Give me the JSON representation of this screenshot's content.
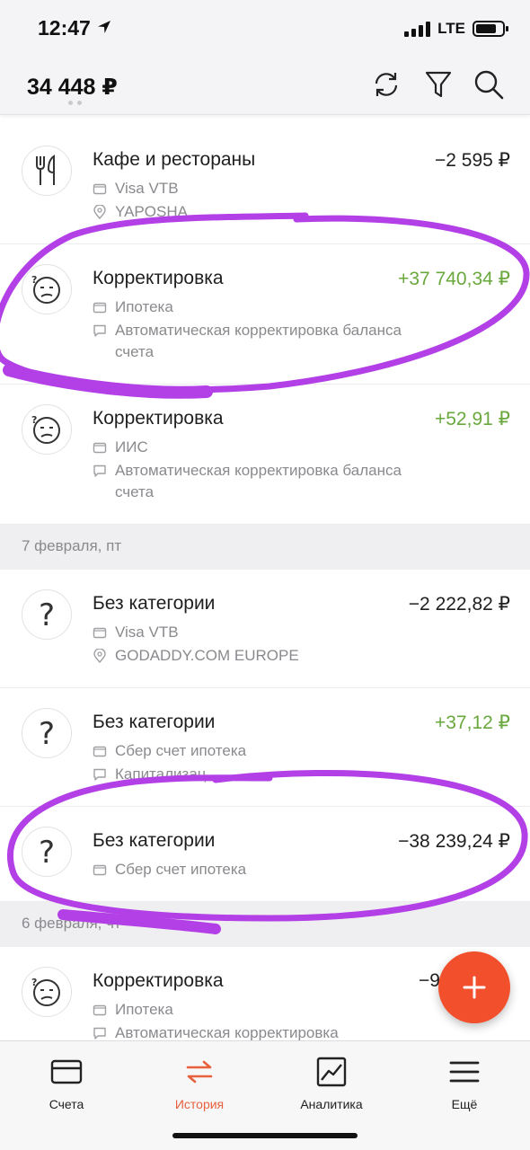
{
  "status_bar": {
    "time": "12:47",
    "network": "LTE"
  },
  "header": {
    "balance": "34 448 ₽"
  },
  "transactions": [
    {
      "category": "Кафе и рестораны",
      "amount": "−2 595 ₽",
      "account": "Visa VTB",
      "note": "YAPOSHA",
      "note_icon": "location-icon",
      "icon": "fork-knife-icon"
    },
    {
      "category": "Корректировка",
      "amount": "+37 740,34 ₽",
      "account": "Ипотека",
      "note": "Автоматическая корректировка баланса счета",
      "note_icon": "comment-icon",
      "icon": "confused-face-icon"
    },
    {
      "category": "Корректировка",
      "amount": "+52,91 ₽",
      "account": "ИИС",
      "note": "Автоматическая корректировка баланса счета",
      "note_icon": "comment-icon",
      "icon": "confused-face-icon"
    },
    {
      "category": "Без категории",
      "amount": "−2 222,82 ₽",
      "account": "Visa VTB",
      "note": "GODADDY.COM EUROPE",
      "note_icon": "location-icon",
      "icon": "question-icon"
    },
    {
      "category": "Без категории",
      "amount": "+37,12 ₽",
      "account": "Сбер счет ипотека",
      "note": "Капитализац",
      "note_icon": "comment-icon",
      "icon": "question-icon"
    },
    {
      "category": "Без категории",
      "amount": "−38 239,24 ₽",
      "account": "Сбер счет ипотека",
      "icon": "question-icon"
    },
    {
      "category": "Корректировка",
      "amount": "−9",
      "account": "Ипотека",
      "note": "Автоматическая корректировка",
      "note_icon": "comment-icon",
      "icon": "confused-face-icon"
    }
  ],
  "dates": [
    "7 февраля, пт",
    "6 февраля, чт"
  ],
  "tabs": [
    {
      "label": "Счета",
      "icon": "card-icon"
    },
    {
      "label": "История",
      "icon": "transfer-arrows-icon",
      "active": true
    },
    {
      "label": "Аналитика",
      "icon": "chart-icon"
    },
    {
      "label": "Ещё",
      "icon": "menu-icon"
    }
  ],
  "fab": {
    "icon": "plus-icon"
  },
  "colors": {
    "accent": "#e8603c",
    "fab": "#f24f2c",
    "positive": "#6aa83e",
    "annotation": "#b33fe6"
  }
}
